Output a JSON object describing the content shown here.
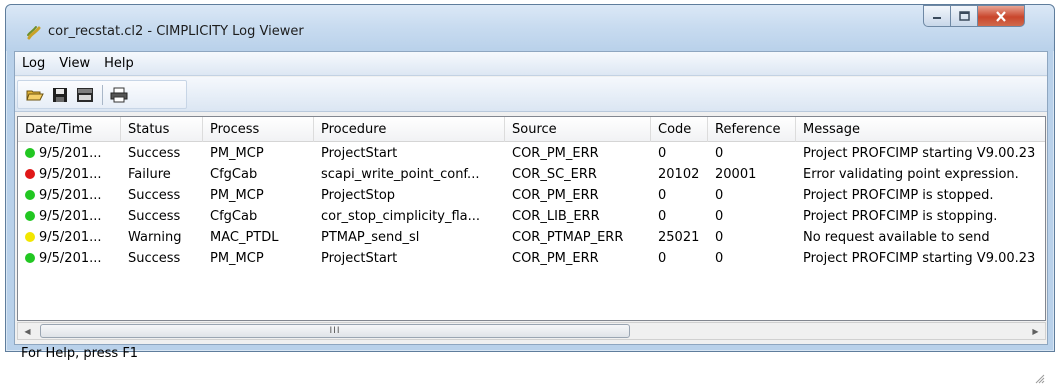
{
  "window": {
    "title": "cor_recstat.cl2 - CIMPLICITY Log Viewer"
  },
  "menu": [
    {
      "label": "Log"
    },
    {
      "label": "View"
    },
    {
      "label": "Help"
    }
  ],
  "toolbar": {
    "buttons": [
      {
        "icon": "open-folder-icon"
      },
      {
        "icon": "save-icon"
      },
      {
        "icon": "csv-export-icon"
      },
      {
        "icon": "print-icon"
      }
    ]
  },
  "table": {
    "columns": [
      "Date/Time",
      "Status",
      "Process",
      "Procedure",
      "Source",
      "Code",
      "Reference",
      "Message"
    ],
    "rows": [
      {
        "status_color": "#22c722",
        "datetime": "9/5/201...",
        "status": "Success",
        "process": "PM_MCP",
        "procedure": "ProjectStart",
        "source": "COR_PM_ERR",
        "code": "0",
        "reference": "0",
        "message": "Project PROFCIMP starting V9.00.23"
      },
      {
        "status_color": "#e01818",
        "datetime": "9/5/201...",
        "status": "Failure",
        "process": "CfgCab",
        "procedure": "scapi_write_point_conf...",
        "source": "COR_SC_ERR",
        "code": "20102",
        "reference": "20001",
        "message": "Error validating point expression."
      },
      {
        "status_color": "#22c722",
        "datetime": "9/5/201...",
        "status": "Success",
        "process": "PM_MCP",
        "procedure": "ProjectStop",
        "source": "COR_PM_ERR",
        "code": "0",
        "reference": "0",
        "message": "Project PROFCIMP is stopped."
      },
      {
        "status_color": "#22c722",
        "datetime": "9/5/201...",
        "status": "Success",
        "process": "CfgCab",
        "procedure": "cor_stop_cimplicity_fla...",
        "source": "COR_LIB_ERR",
        "code": "0",
        "reference": "0",
        "message": "Project PROFCIMP is stopping."
      },
      {
        "status_color": "#f2e600",
        "datetime": "9/5/201...",
        "status": "Warning",
        "process": "MAC_PTDL",
        "procedure": "PTMAP_send_sl",
        "source": "COR_PTMAP_ERR",
        "code": "25021",
        "reference": "0",
        "message": "No request available to send"
      },
      {
        "status_color": "#22c722",
        "datetime": "9/5/201...",
        "status": "Success",
        "process": "PM_MCP",
        "procedure": "ProjectStart",
        "source": "COR_PM_ERR",
        "code": "0",
        "reference": "0",
        "message": "Project PROFCIMP starting V9.00.23"
      }
    ]
  },
  "scrollbar": {
    "thumb_grip": "III",
    "left_arrow": "◀",
    "right_arrow": "▶"
  },
  "status_bar": {
    "text": "For Help, press F1"
  }
}
